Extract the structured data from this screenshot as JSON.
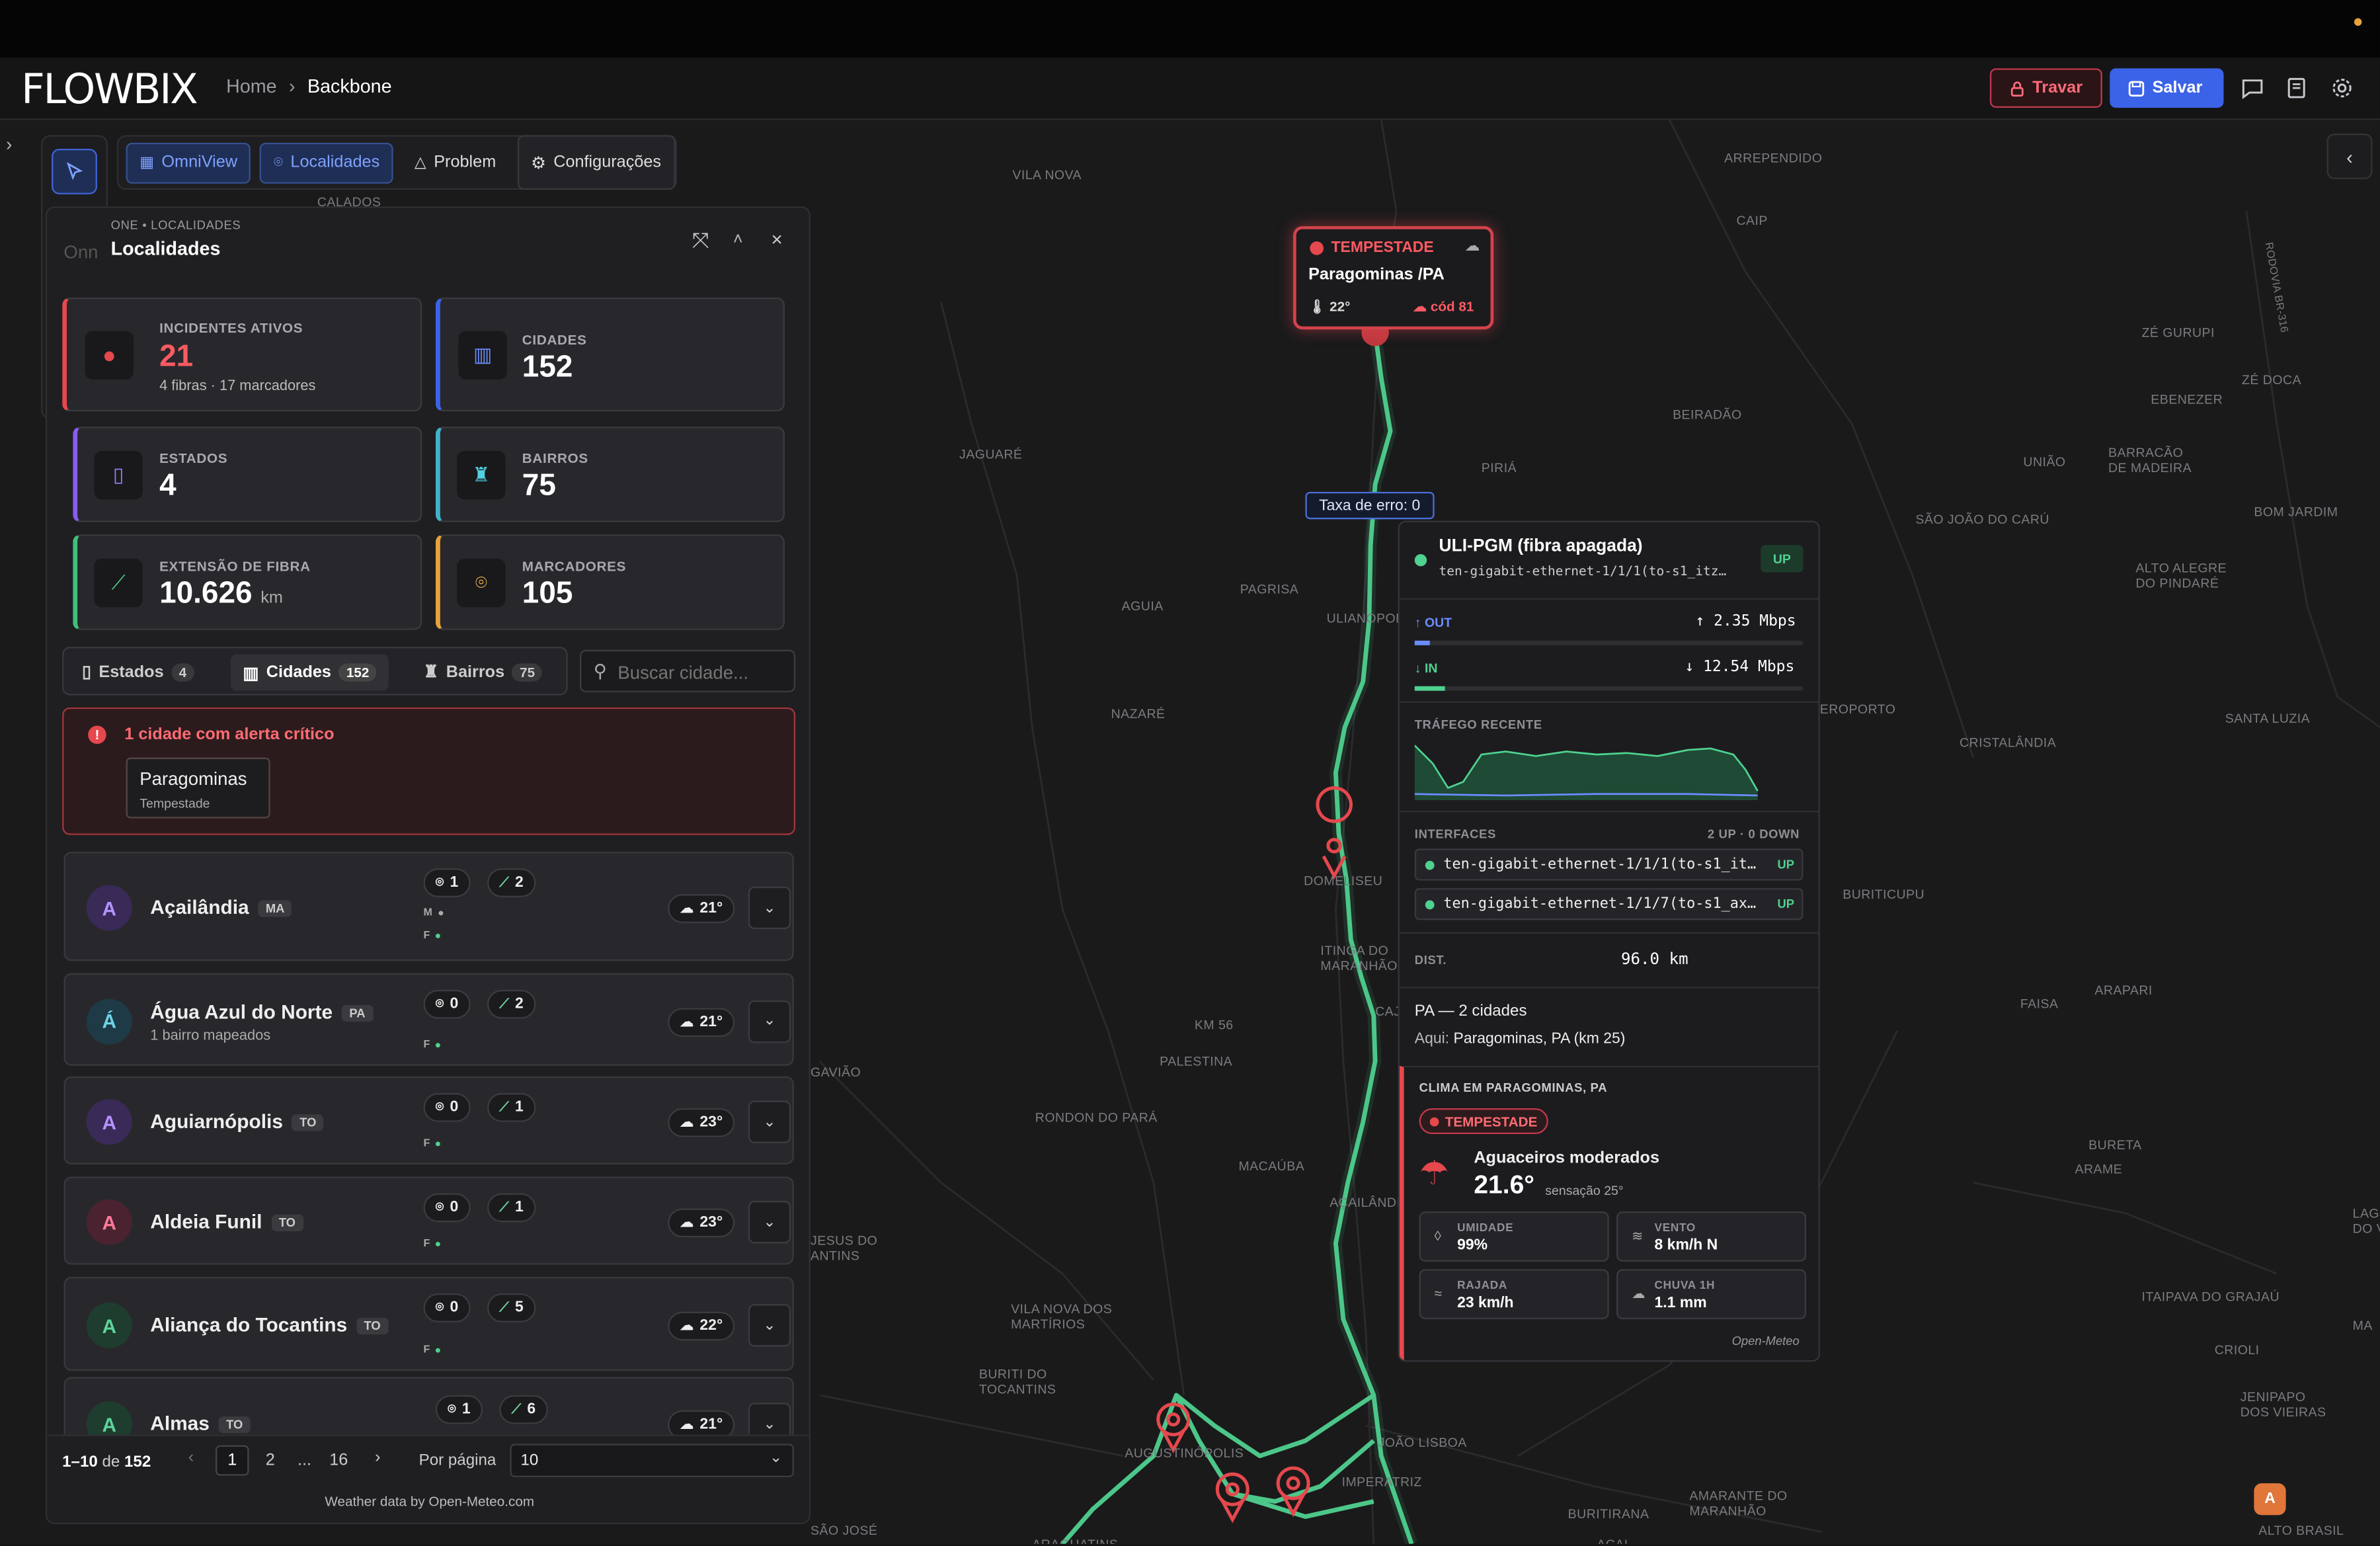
{
  "app": {
    "logo": "FLOWBIX",
    "breadcrumb": [
      "Home",
      "Backbone"
    ],
    "travar": "Travar",
    "salvar": "Salvar"
  },
  "map": {
    "labels": [
      "VILA NOVA",
      "ARREPENDIDO",
      "CAIP",
      "CALADOS",
      "ZÉ GURUPI",
      "ZÉ DOCA",
      "EBENEZER",
      "BEIRADÃO",
      "UNIÃO",
      "BARRACÃO",
      "DE MADEIRA",
      "BOM JARDIM",
      "PIRIÁ",
      "JAGUARÉ",
      "SÃO JOÃO DO CARÚ",
      "ALTO ALEGRE",
      "DO PINDARÉ",
      "PAGRISA",
      "AGUIA",
      "ULIANÓPOLIS",
      "NAZARÉ",
      "EROPORTO",
      "SANTA LUZIA",
      "CRISTALÂNDIA",
      "DOMELISEU",
      "BURITICUPU",
      "ITINGA DO",
      "MARANHÃO",
      "CAJ",
      "KM 56",
      "PALESTINA",
      "FAISA",
      "ARAPARI",
      "RONDON DO PARÁ",
      "GAVIÃO",
      "MACAÚBA",
      "AÇAILÂNDIA",
      "BURETA",
      "ARAME",
      "JESUS DO",
      "ANTINS",
      "VILA NOVA DOS",
      "MARTÍRIOS",
      "BURITI DO",
      "TOCANTINS",
      "ITAIPAVA DO GRAJAÚ",
      "CRIOLI",
      "AUGUSTINÓPOLIS",
      "JOÃO LISBOA",
      "IMPERATRIZ",
      "JENIPAPO",
      "DOS VIEIRAS",
      "BURITIRANA",
      "AMARANTE DO",
      "MARANHÃO",
      "LAG",
      "DO V",
      "SÃO JOSÉ",
      "ARAGUATINS",
      "AÇAI",
      "ALTO BRASIL",
      "MA"
    ],
    "rodovia": "RODOVIA BR-316",
    "marker_letter": "A"
  },
  "tabs": [
    "OmniView",
    "Localidades",
    "Problem",
    "Configurações"
  ],
  "alert_pin": {
    "tag": "TEMPESTADE",
    "city": "Paragominas /PA",
    "temp": "22°",
    "code": "cód 81"
  },
  "error_tag": "Taxa de erro: 0",
  "panel": {
    "crumb": "ONE • LOCALIDADES",
    "ghost": "Onn",
    "title": "Localidades",
    "stats": [
      {
        "label": "INCIDENTES ATIVOS",
        "value": "21",
        "sub": "4 fibras · 17 marcadores",
        "unit": ""
      },
      {
        "label": "CIDADES",
        "value": "152",
        "sub": "",
        "unit": ""
      },
      {
        "label": "ESTADOS",
        "value": "4",
        "sub": "",
        "unit": ""
      },
      {
        "label": "BAIRROS",
        "value": "75",
        "sub": "",
        "unit": ""
      },
      {
        "label": "EXTENSÃO DE FIBRA",
        "value": "10.626",
        "sub": "",
        "unit": "km"
      },
      {
        "label": "MARCADORES",
        "value": "105",
        "sub": "",
        "unit": ""
      }
    ],
    "filters": [
      {
        "label": "Estados",
        "count": "4"
      },
      {
        "label": "Cidades",
        "count": "152"
      },
      {
        "label": "Bairros",
        "count": "75"
      }
    ],
    "search_placeholder": "Buscar cidade...",
    "alert": {
      "title": "1 cidade com alerta crítico",
      "city": "Paragominas",
      "type": "Tempestade"
    },
    "cities": [
      {
        "initial": "A",
        "name": "Açailândia",
        "uf": "MA",
        "sub": "",
        "pins": "1",
        "fibers": "2",
        "temp": "21°",
        "mf": [
          "M",
          "F"
        ]
      },
      {
        "initial": "Á",
        "name": "Água Azul do Norte",
        "uf": "PA",
        "sub": "1 bairro mapeados",
        "pins": "0",
        "fibers": "2",
        "temp": "21°",
        "mf": [
          "F"
        ]
      },
      {
        "initial": "A",
        "name": "Aguiarnópolis",
        "uf": "TO",
        "sub": "",
        "pins": "0",
        "fibers": "1",
        "temp": "23°",
        "mf": [
          "F"
        ]
      },
      {
        "initial": "A",
        "name": "Aldeia Funil",
        "uf": "TO",
        "sub": "",
        "pins": "0",
        "fibers": "1",
        "temp": "23°",
        "mf": [
          "F"
        ]
      },
      {
        "initial": "A",
        "name": "Aliança do Tocantins",
        "uf": "TO",
        "sub": "",
        "pins": "0",
        "fibers": "5",
        "temp": "22°",
        "mf": [
          "F"
        ]
      },
      {
        "initial": "A",
        "name": "Almas",
        "uf": "TO",
        "sub": "",
        "pins": "1",
        "fibers": "6",
        "temp": "21°",
        "mf": []
      }
    ],
    "pagination": {
      "range": "1–10",
      "de": "de",
      "total": "152",
      "pages": [
        "1",
        "2",
        "...",
        "16"
      ],
      "per_page_label": "Por página",
      "per_page": "10"
    },
    "footer": "Weather data by Open-Meteo.com"
  },
  "popup": {
    "title": "ULI-PGM (fibra apagada)",
    "iface": "ten-gigabit-ethernet-1/1/1(to-s1_itz…",
    "status": "UP",
    "out_label": "OUT",
    "out_value": "↑ 2.35 Mbps",
    "in_label": "IN",
    "in_value": "↓ 12.54 Mbps",
    "traffic_label": "TRÁFEGO RECENTE",
    "interfaces_label": "INTERFACES",
    "interfaces_summary": "2 UP · 0 DOWN",
    "interfaces": [
      {
        "name": "ten-gigabit-ethernet-1/1/1(to-s1_it…",
        "status": "UP"
      },
      {
        "name": "ten-gigabit-ethernet-1/1/7(to-s1_ax…",
        "status": "UP"
      }
    ],
    "dist_label": "DIST.",
    "dist_value": "96.0 km",
    "state_line": "PA — 2 cidades",
    "here_label": "Aqui:",
    "here_value": "Paragominas, PA (km 25)",
    "weather": {
      "title": "CLIMA EM PARAGOMINAS, PA",
      "tag": "TEMPESTADE",
      "desc": "Aguaceiros moderados",
      "temp": "21.6°",
      "feel": "sensação 25°",
      "cells": [
        {
          "label": "UMIDADE",
          "value": "99%"
        },
        {
          "label": "VENTO",
          "value": "8 km/h N"
        },
        {
          "label": "RAJADA",
          "value": "23 km/h"
        },
        {
          "label": "CHUVA 1H",
          "value": "1.1 mm"
        }
      ],
      "source": "Open-Meteo"
    }
  },
  "colors": {
    "accent": "#3b63e8",
    "fiber": "#4fd18f",
    "alert": "#e5484d",
    "bg": "#1a1a1b"
  }
}
